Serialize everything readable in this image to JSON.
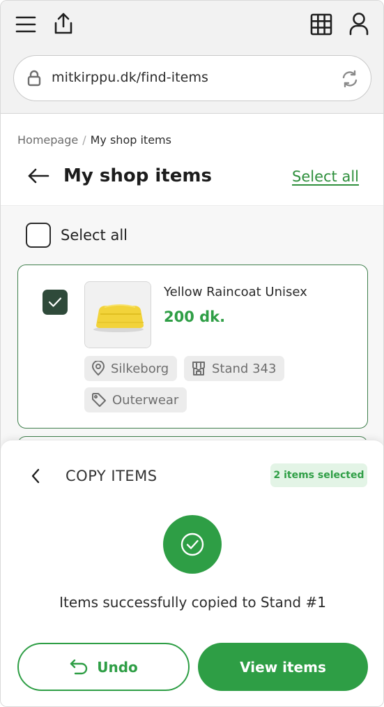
{
  "browser": {
    "url": "mitkirppu.dk/find-items"
  },
  "breadcrumb": {
    "home": "Homepage",
    "separator": "/",
    "current": "My shop items"
  },
  "page": {
    "title": "My shop items",
    "select_all_link": "Select all"
  },
  "list": {
    "select_all_label": "Select all",
    "items": [
      {
        "name": "Yellow Raincoat Unisex",
        "price": "200 dk.",
        "checked": true,
        "location": "Silkeborg",
        "stand": "Stand 343",
        "category": "Outerwear"
      }
    ]
  },
  "sheet": {
    "title": "COPY ITEMS",
    "badge": "2 items selected",
    "message": "Items successfully copied to Stand #1",
    "undo_label": "Undo",
    "view_label": "View items"
  },
  "colors": {
    "accent": "#2e9e45",
    "checked_box": "#2f4a3a",
    "card_border": "#3f7f4c",
    "badge_bg": "#e3f4e6"
  }
}
